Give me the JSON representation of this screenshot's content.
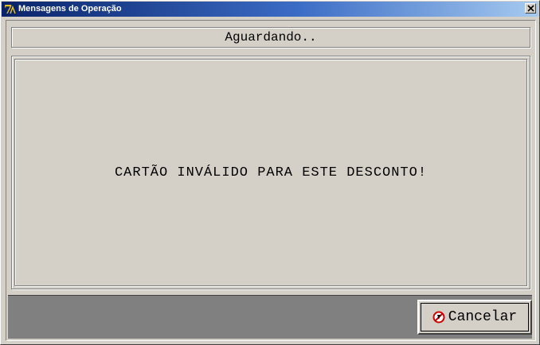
{
  "window": {
    "title": "Mensagens de Operação",
    "app_icon_text": "7"
  },
  "status": {
    "text": "Aguardando.."
  },
  "message": {
    "text": "CARTÃO INVÁLIDO PARA ESTE DESCONTO!"
  },
  "buttons": {
    "cancel_label": "Cancelar",
    "cancel_icon": "cancel-icon"
  },
  "colors": {
    "titlebar_start": "#0a246a",
    "titlebar_end": "#a6caf0",
    "face": "#d4d0c8",
    "bottom_bar": "#808080"
  }
}
